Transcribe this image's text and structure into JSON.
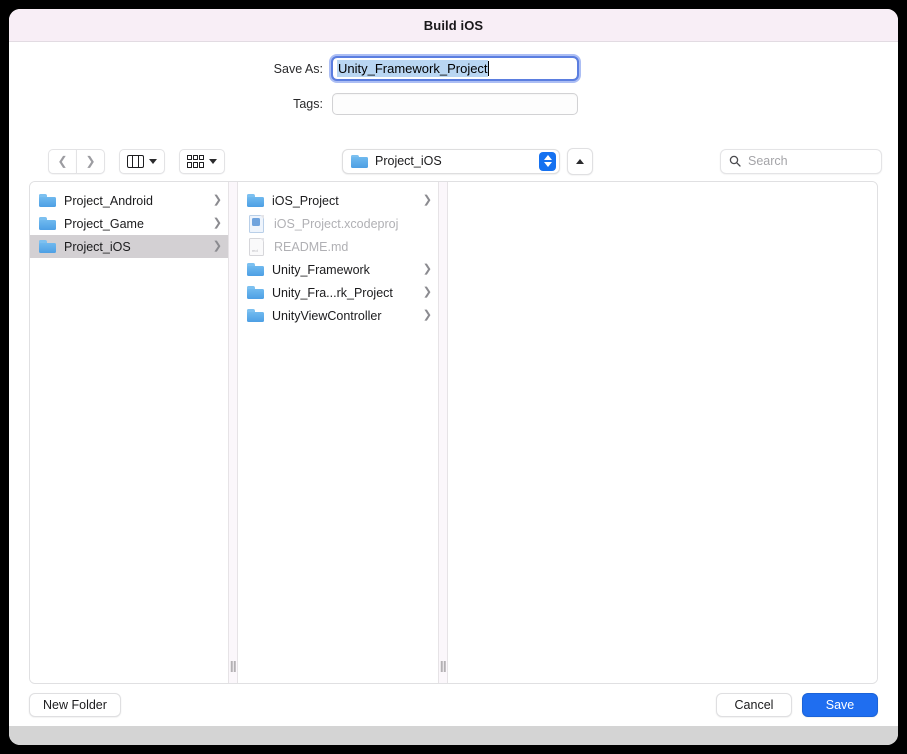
{
  "window": {
    "title": "Build iOS"
  },
  "form": {
    "save_as_label": "Save As:",
    "save_as_value": "Unity_Framework_Project",
    "tags_label": "Tags:",
    "tags_value": "",
    "tags_placeholder": ""
  },
  "toolbar": {
    "back_icon": "chevron-left-icon",
    "forward_icon": "chevron-right-icon",
    "view_mode_icon": "column-view-icon",
    "group_by_icon": "grid-view-icon",
    "path_label": "Project_iOS",
    "path_folder_icon": "folder-icon",
    "stepper_icon": "up-down-stepper-icon",
    "up_button_icon": "chevron-up-icon",
    "search_icon": "search-icon",
    "search_value": "",
    "search_placeholder": "Search"
  },
  "browser": {
    "columns": [
      {
        "name": "column-1",
        "items": [
          {
            "label": "Project_Android",
            "icon": "folder-icon",
            "kind": "folder",
            "selected": false,
            "disabled": false,
            "has_arrow": true
          },
          {
            "label": "Project_Game",
            "icon": "folder-icon",
            "kind": "folder",
            "selected": false,
            "disabled": false,
            "has_arrow": true
          },
          {
            "label": "Project_iOS",
            "icon": "folder-icon",
            "kind": "folder",
            "selected": true,
            "disabled": false,
            "has_arrow": true
          }
        ]
      },
      {
        "name": "column-2",
        "items": [
          {
            "label": "iOS_Project",
            "icon": "folder-icon",
            "kind": "folder",
            "selected": false,
            "disabled": false,
            "has_arrow": true
          },
          {
            "label": "iOS_Project.xcodeproj",
            "icon": "xcodeproj-document-icon",
            "kind": "xcodeproj",
            "selected": false,
            "disabled": true,
            "has_arrow": false
          },
          {
            "label": "README.md",
            "icon": "document-icon",
            "kind": "document",
            "selected": false,
            "disabled": true,
            "has_arrow": false
          },
          {
            "label": "Unity_Framework",
            "icon": "folder-icon",
            "kind": "folder",
            "selected": false,
            "disabled": false,
            "has_arrow": true
          },
          {
            "label": "Unity_Fra...rk_Project",
            "icon": "folder-icon",
            "kind": "folder",
            "selected": false,
            "disabled": false,
            "has_arrow": true
          },
          {
            "label": "UnityViewController",
            "icon": "folder-icon",
            "kind": "folder",
            "selected": false,
            "disabled": false,
            "has_arrow": true
          }
        ]
      },
      {
        "name": "column-3",
        "items": []
      }
    ]
  },
  "footer": {
    "new_folder_label": "New Folder",
    "cancel_label": "Cancel",
    "save_label": "Save"
  },
  "colors": {
    "titlebar_bg": "#f8eef6",
    "accent_blue": "#1f6ef0",
    "selection_gray": "#d3d0d3",
    "text_selection_blue": "#b9d6f2",
    "folder_blue": "#4d9fe4",
    "disabled_text": "#b0b0b4"
  }
}
